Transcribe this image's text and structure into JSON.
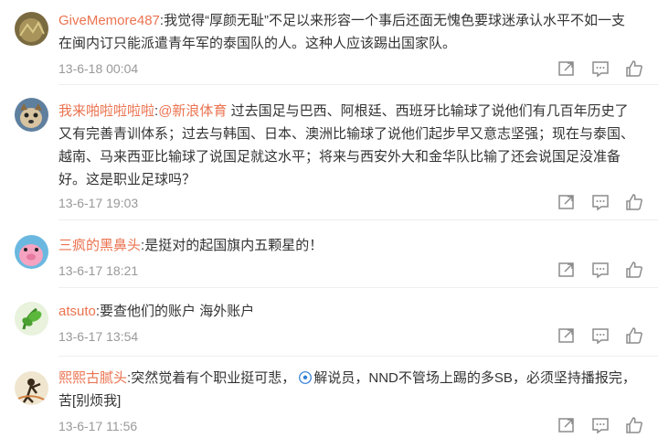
{
  "comments": [
    {
      "username": "GiveMemore487",
      "sep": ":",
      "lines": [
        "我觉得“厚颜无耻”不足以来形容一个事后还面无愧色要球迷承认水平不如一支",
        "在闽内订只能派遣青年军的泰国队的人。这种人应该踢出国家队。"
      ],
      "time": "13-6-18 00:04"
    },
    {
      "username": "我来啪啦啦啦啦",
      "sep": ":",
      "mention": "@新浪体育",
      "lines": [
        "过去国足与巴西、阿根廷、西班牙比输球了说他们有几百年历史了",
        "又有完善青训体系；过去与韩国、日本、澳洲比输球了说他们起步早又意志坚强；现在与泰国、",
        "越南、马来西亚比输球了说国足就这水平；将来与西安外大和金华队比输了还会说国足没准备",
        "好。这是职业足球吗？"
      ],
      "time": "13-6-17 19:03"
    },
    {
      "username": "三疯的黑鼻头",
      "sep": ":",
      "lines": [
        "是挺对的起国旗内五颗星的！"
      ],
      "time": "13-6-17 18:21"
    },
    {
      "username": "atsuto",
      "sep": ":",
      "lines": [
        "要查他们的账户 海外账户"
      ],
      "time": "13-6-17 13:54"
    },
    {
      "username": "熙熙古腻头",
      "sep": ":",
      "lines": [
        "突然觉着有个职业挺可悲，",
        "解说员，NND不管场上踢的多SB，必须坚持播报完，",
        "苦[别烦我]"
      ],
      "time": "13-6-17 11:56"
    }
  ],
  "icons": {
    "share": "share-icon",
    "comment": "comment-icon",
    "like": "thumbs-up-icon",
    "football": "football-icon"
  },
  "colors": {
    "username": "#eb7350",
    "text": "#333333",
    "time": "#999999",
    "icon": "#8c8c8c"
  }
}
